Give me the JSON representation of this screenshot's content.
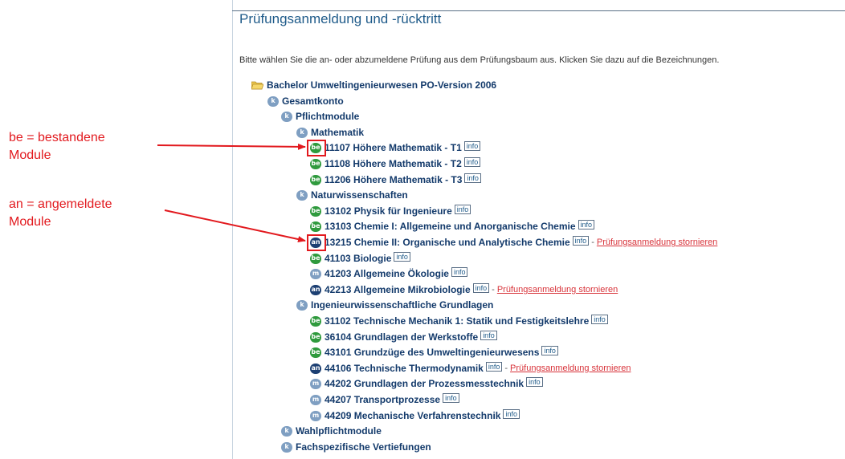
{
  "page": {
    "title": "Prüfungsanmeldung und -rücktritt",
    "intro": "Bitte wählen Sie die an- oder abzumeldene Prüfung aus dem Prüfungsbaum aus. Klicken Sie dazu auf die Bezeichnungen."
  },
  "annotations": {
    "be_line1": "be = bestandene",
    "be_line2": "Module",
    "an_line1": "an = angemeldete",
    "an_line2": "Module",
    "highlight_color": "#e2191e"
  },
  "icon_labels": {
    "k": "k",
    "be": "be",
    "an": "an",
    "m": "m"
  },
  "info_label": "info",
  "cancel_label": "Prüfungsanmeldung stornieren",
  "tree": [
    {
      "icon": "folder",
      "level": 0,
      "label": "Bachelor Umweltingenieurwesen PO-Version 2006"
    },
    {
      "icon": "k",
      "level": 1,
      "label": "Gesamtkonto"
    },
    {
      "icon": "k",
      "level": 2,
      "label": "Pflichtmodule"
    },
    {
      "icon": "k",
      "level": 3,
      "label": "Mathematik"
    },
    {
      "icon": "be",
      "level": 4,
      "label": "11107 Höhere Mathematik - T1",
      "info": true
    },
    {
      "icon": "be",
      "level": 4,
      "label": "11108 Höhere Mathematik - T2",
      "info": true
    },
    {
      "icon": "be",
      "level": 4,
      "label": "11206 Höhere Mathematik - T3",
      "info": true
    },
    {
      "icon": "k",
      "level": 3,
      "label": "Naturwissenschaften"
    },
    {
      "icon": "be",
      "level": 4,
      "label": "13102 Physik für Ingenieure",
      "info": true
    },
    {
      "icon": "be",
      "level": 4,
      "label": "13103 Chemie I: Allgemeine und Anorganische Chemie",
      "info": true
    },
    {
      "icon": "an",
      "level": 4,
      "label": "13215 Chemie II: Organische und Analytische Chemie",
      "info": true,
      "cancel": true
    },
    {
      "icon": "be",
      "level": 4,
      "label": "41103 Biologie",
      "info": true
    },
    {
      "icon": "m",
      "level": 4,
      "label": "41203 Allgemeine Ökologie",
      "info": true
    },
    {
      "icon": "an",
      "level": 4,
      "label": "42213 Allgemeine Mikrobiologie",
      "info": true,
      "cancel": true
    },
    {
      "icon": "k",
      "level": 3,
      "label": "Ingenieurwissenschaftliche Grundlagen"
    },
    {
      "icon": "be",
      "level": 4,
      "label": "31102 Technische Mechanik 1: Statik und Festigkeitslehre",
      "info": true
    },
    {
      "icon": "be",
      "level": 4,
      "label": "36104 Grundlagen der Werkstoffe",
      "info": true
    },
    {
      "icon": "be",
      "level": 4,
      "label": "43101 Grundzüge des Umweltingenieurwesens",
      "info": true
    },
    {
      "icon": "an",
      "level": 4,
      "label": "44106 Technische Thermodynamik",
      "info": true,
      "cancel": true
    },
    {
      "icon": "m",
      "level": 4,
      "label": "44202 Grundlagen der Prozessmesstechnik",
      "info": true
    },
    {
      "icon": "m",
      "level": 4,
      "label": "44207 Transportprozesse",
      "info": true
    },
    {
      "icon": "m",
      "level": 4,
      "label": "44209 Mechanische Verfahrenstechnik",
      "info": true
    },
    {
      "icon": "k",
      "level": 2,
      "label": "Wahlpflichtmodule"
    },
    {
      "icon": "k",
      "level": 2,
      "label": "Fachspezifische Vertiefungen"
    }
  ]
}
